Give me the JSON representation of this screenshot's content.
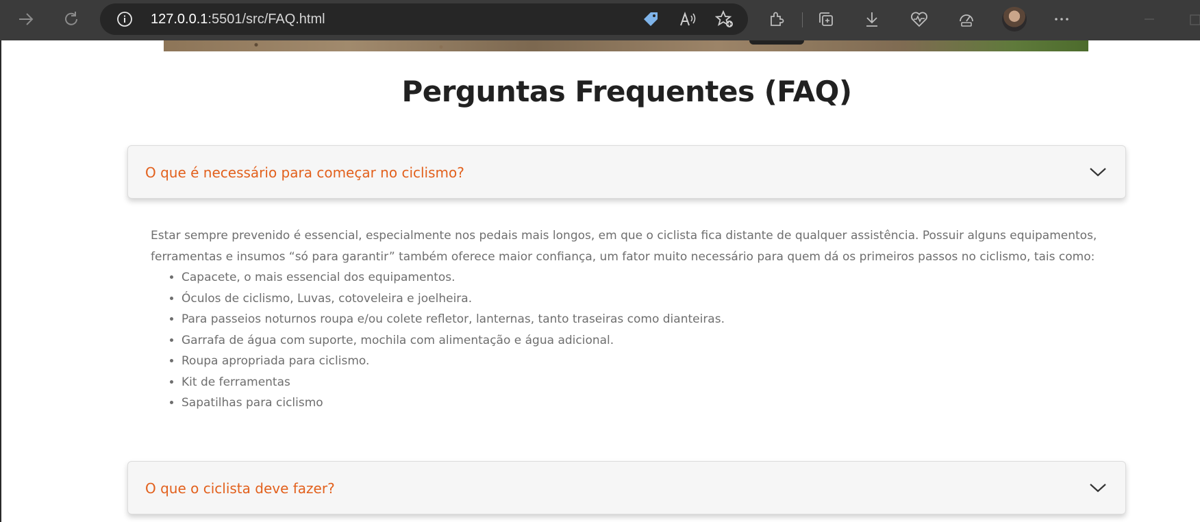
{
  "browser": {
    "url_host": "127.0.0.1",
    "url_rest": ":5501/src/FAQ.html",
    "icons": [
      "back-arrow-icon",
      "refresh-icon",
      "info-icon",
      "tag-icon",
      "read-aloud-icon",
      "favorite-add-icon",
      "extensions-icon",
      "collections-icon",
      "download-icon",
      "health-icon",
      "performance-icon",
      "avatar",
      "more-icon"
    ]
  },
  "page": {
    "title": "Perguntas Frequentes (FAQ)",
    "faq": [
      {
        "question": "O que é necessário para começar no ciclismo?",
        "answer_intro": "Estar sempre prevenido é essencial, especialmente nos pedais mais longos, em que o ciclista fica distante de qualquer assistência. Possuir alguns equipamentos, ferramentas e insumos “só para garantir” também oferece maior confiança, um fator muito necessário para quem dá os primeiros passos no ciclismo, tais como:",
        "items": [
          "Capacete, o mais essencial dos equipamentos.",
          "Óculos de ciclismo, Luvas, cotoveleira e joelheira.",
          "Para passeios noturnos roupa e/ou colete refletor, lanternas, tanto traseiras como dianteiras.",
          "Garrafa de água com suporte, mochila com alimentação e água adicional.",
          "Roupa apropriada para ciclismo.",
          "Kit de ferramentas",
          "Sapatilhas para ciclismo"
        ]
      },
      {
        "question": "O que o ciclista deve fazer?"
      }
    ]
  },
  "colors": {
    "accent": "#e2601c",
    "chrome": "#3b3b3b",
    "title": "#212121",
    "body_text": "#6e6e6e"
  }
}
